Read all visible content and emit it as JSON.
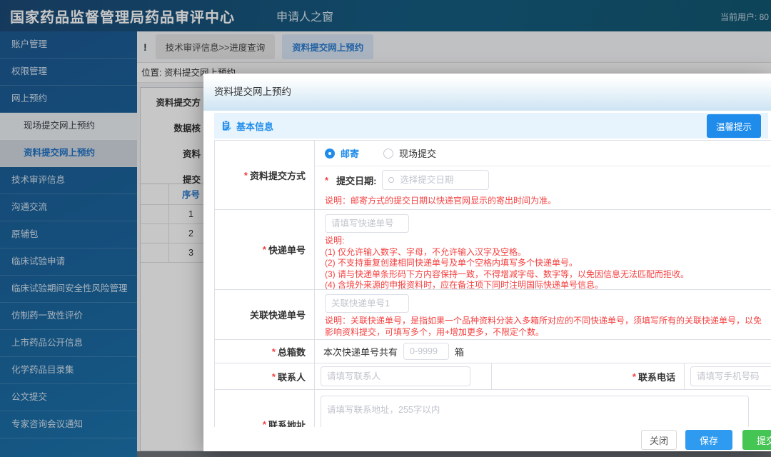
{
  "ui": {
    "required_marker": "*"
  },
  "colors": {
    "accent": "#1f8ceb",
    "save_button": "#2e9bf1",
    "submit_button": "#45c553",
    "note_red": "#f53f3f",
    "header_bg": "#155d81",
    "sidebar_bg": "#1b69a2"
  },
  "header": {
    "title": "国家药品监督管理局药品审评中心",
    "portal": "申请人之窗",
    "current_user": "当前用户: 80"
  },
  "tabbar": {
    "alert": "!",
    "tabs": [
      {
        "label": "技术审评信息>>进度查询"
      },
      {
        "label": "资料提交网上预约"
      }
    ]
  },
  "breadcrumb": {
    "text": "位置: 资料提交网上预约"
  },
  "sidebar": {
    "items": [
      {
        "label": "账户管理"
      },
      {
        "label": "权限管理"
      },
      {
        "label": "网上预约"
      },
      {
        "label": "现场提交网上预约"
      },
      {
        "label": "资料提交网上预约"
      },
      {
        "label": "技术审评信息"
      },
      {
        "label": "沟通交流"
      },
      {
        "label": "原辅包"
      },
      {
        "label": "临床试验申请"
      },
      {
        "label": "临床试验期间安全性风险管理"
      },
      {
        "label": "仿制药一致性评价"
      },
      {
        "label": "上市药品公开信息"
      },
      {
        "label": "化学药品目录集"
      },
      {
        "label": "公文提交"
      },
      {
        "label": "专家咨询会议通知"
      }
    ]
  },
  "background": {
    "field_labels": [
      "资料提交方",
      "数据核",
      "资料",
      "提交"
    ],
    "table": {
      "header_seq": "序号",
      "rows": [
        "1",
        "2",
        "3"
      ]
    }
  },
  "modal": {
    "title": "资料提交网上预约",
    "section": {
      "title": "基本信息",
      "tip_button": "温馨提示"
    },
    "form": {
      "method": {
        "label": "资料提交方式",
        "mail": "邮寄",
        "onsite": "现场提交",
        "date_label": "提交日期:",
        "date_placeholder": "选择提交日期",
        "note": "说明：邮寄方式的提交日期以快递官网显示的寄出时间为准。"
      },
      "tracking": {
        "label": "快递单号",
        "placeholder": "请填写快递单号",
        "note_title": "说明:",
        "notes": [
          "(1) 仅允许输入数字、字母，不允许输入汉字及空格。",
          "(2) 不支持重复创建相同快递单号及单个空格内填写多个快递单号。",
          "(3) 请与快递单条形码下方内容保持一致，不得增减字母、数字等，以免因信息无法匹配而拒收。",
          "(4) 含境外来源的申报资料时，应在备注项下同时注明国际快递单号信息。"
        ]
      },
      "related": {
        "label": "关联快递单号",
        "placeholder": "关联快递单号1",
        "note": "说明：关联快递单号，是指如果一个品种资料分装入多箱所对应的不同快递单号，须填写所有的关联快递单号，以免影响资料提交，可填写多个，用+增加更多，不限定个数。"
      },
      "boxes": {
        "label": "总箱数",
        "prefix": "本次快递单号共有",
        "placeholder": "0-9999",
        "suffix": "箱"
      },
      "contact": {
        "label": "联系人",
        "placeholder": "请填写联系人"
      },
      "phone": {
        "label": "联系电话",
        "placeholder": "请填写手机号码"
      },
      "address": {
        "label": "联系地址",
        "placeholder": "请填写联系地址，255字以内"
      }
    },
    "footer": {
      "close": "关闭",
      "save": "保存",
      "submit": "提交"
    }
  }
}
